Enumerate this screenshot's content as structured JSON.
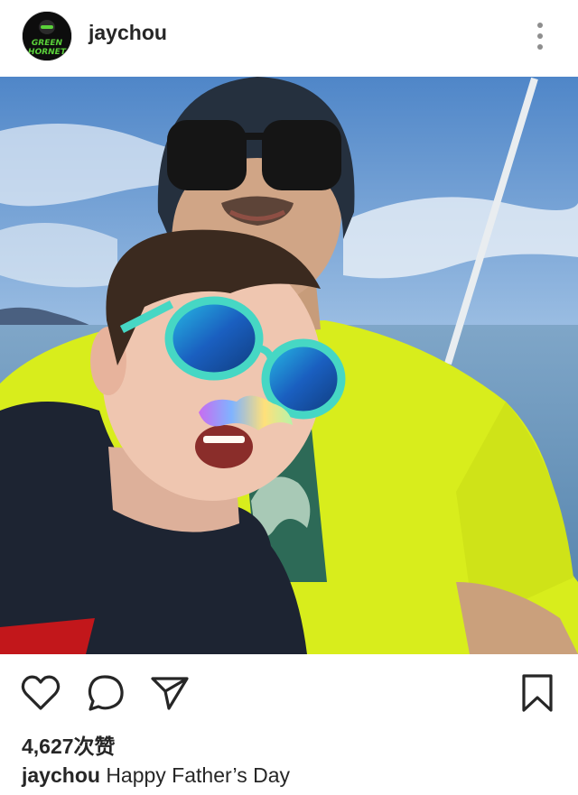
{
  "post": {
    "username": "jaychou",
    "avatar_text": [
      "GREEN",
      "HORNET"
    ],
    "likes_text": "4,627次赞",
    "caption": {
      "username": "jaychou",
      "text": "Happy Father’s Day"
    }
  },
  "icons": {
    "more": "more-vertical-icon",
    "like": "heart-icon",
    "comment": "comment-icon",
    "share": "send-icon",
    "save": "bookmark-icon"
  },
  "colors": {
    "text": "#262626",
    "shirt_yellow": "#d9ee1c",
    "sky": "#6c9fd6",
    "sea": "#5f8fb8",
    "sunglasses_lens": "#1f6fd0",
    "frame_teal": "#46d7c4"
  }
}
